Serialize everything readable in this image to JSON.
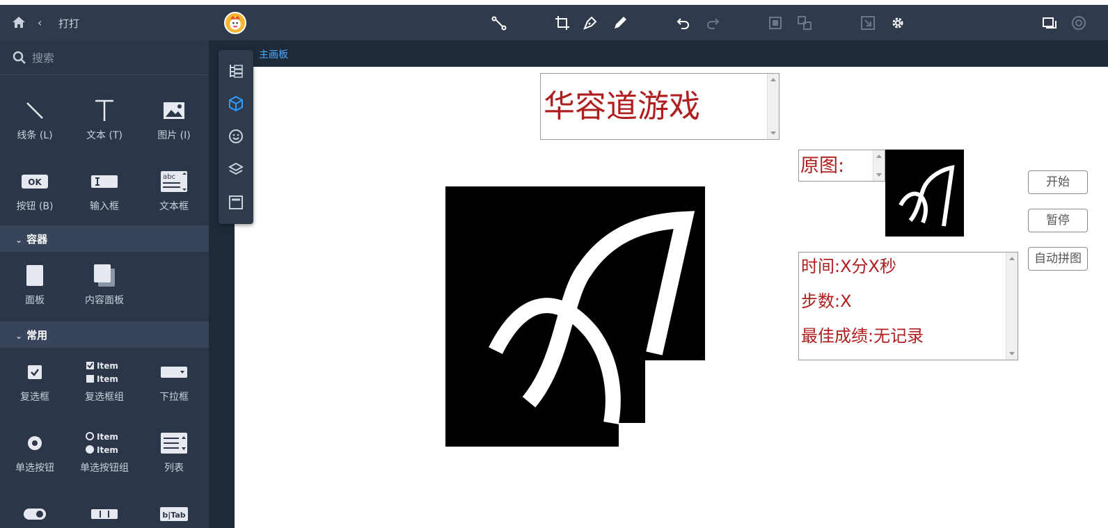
{
  "topbar": {
    "project_name": "打打",
    "back_icon": "chevron-left-icon",
    "home_icon": "home-icon"
  },
  "sidebar": {
    "search_placeholder": "搜索",
    "basic": [
      {
        "label": "线条 (L)",
        "icon": "line-icon"
      },
      {
        "label": "文本 (T)",
        "icon": "text-icon"
      },
      {
        "label": "图片 (I)",
        "icon": "image-icon"
      },
      {
        "label": "按钮 (B)",
        "icon": "button-icon"
      },
      {
        "label": "输入框",
        "icon": "input-icon"
      },
      {
        "label": "文本框",
        "icon": "textarea-icon"
      }
    ],
    "section_container": "容器",
    "container": [
      {
        "label": "面板",
        "icon": "panel-icon"
      },
      {
        "label": "内容面板",
        "icon": "content-panel-icon"
      }
    ],
    "section_common": "常用",
    "common": [
      {
        "label": "复选框",
        "icon": "checkbox-icon"
      },
      {
        "label": "复选框组",
        "icon": "checkbox-group-icon"
      },
      {
        "label": "下拉框",
        "icon": "dropdown-icon"
      },
      {
        "label": "单选按钮",
        "icon": "radio-icon"
      },
      {
        "label": "单选按钮组",
        "icon": "radio-group-icon"
      },
      {
        "label": "列表",
        "icon": "list-icon"
      }
    ],
    "item_text": "Item",
    "ok_text": "OK",
    "abc_text": "abc",
    "btab_text": "b|Tab"
  },
  "breadcrumb": "主画板",
  "canvas": {
    "title": "华容道游戏",
    "original_label": "原图:",
    "time_line": "时间:X分X秒",
    "steps_line": "步数:X",
    "best_line": "最佳成绩:无记录",
    "btn_start": "开始",
    "btn_pause": "暂停",
    "btn_auto": "自动拼图"
  },
  "colors": {
    "accent_text": "#b01f1f",
    "sidebar_bg": "#2b3648",
    "topbar_bg": "#2f3b4c",
    "link_blue": "#4aa8ff"
  }
}
